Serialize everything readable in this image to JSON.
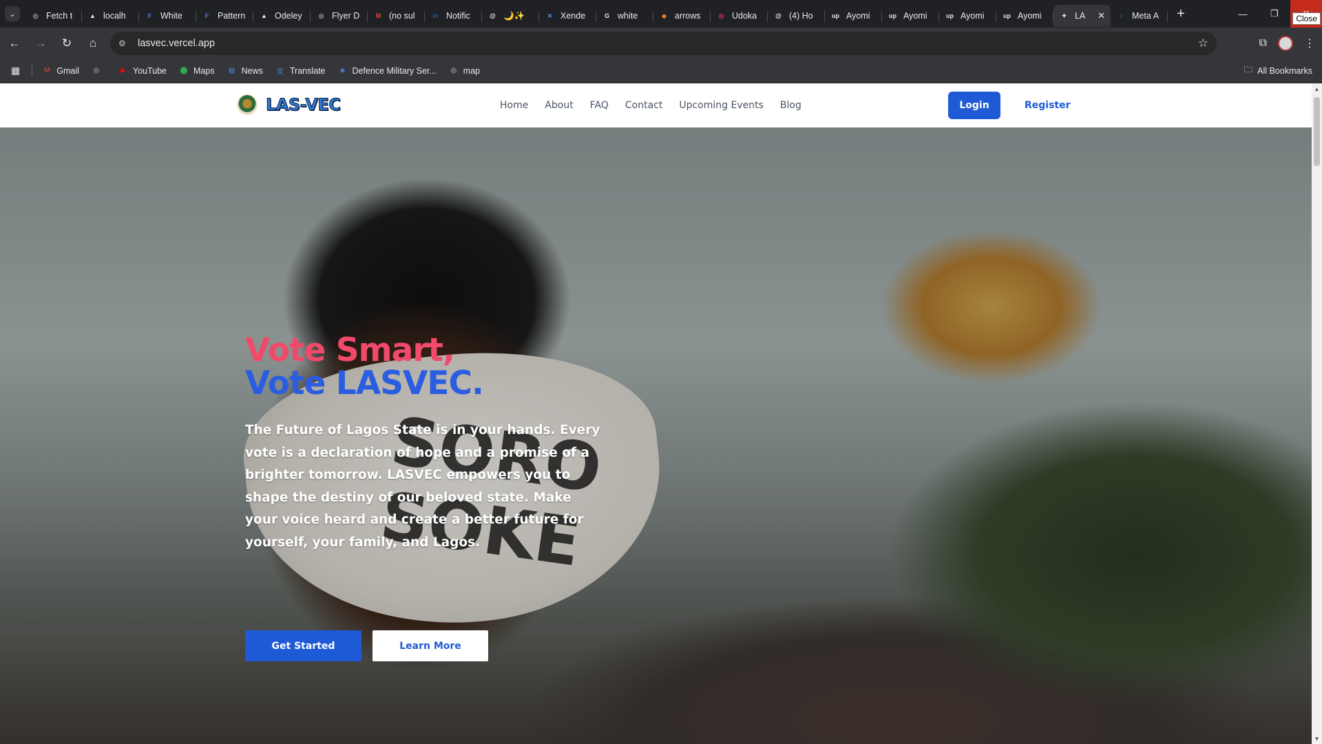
{
  "browser": {
    "tabs": [
      {
        "title": "Fetch t",
        "icon": "globe-icon",
        "color": "#9aa0a6"
      },
      {
        "title": "localh",
        "icon": "triangle-icon",
        "color": "#e8eaed"
      },
      {
        "title": "White",
        "icon": "f-icon",
        "color": "#4a7bd8"
      },
      {
        "title": "Pattern",
        "icon": "f-icon",
        "color": "#4a7bd8"
      },
      {
        "title": "Odeley",
        "icon": "triangle-icon",
        "color": "#e8eaed"
      },
      {
        "title": "Flyer D",
        "icon": "globe-icon",
        "color": "#9aa0a6"
      },
      {
        "title": "(no sul",
        "icon": "gmail-icon",
        "color": "#ea4335"
      },
      {
        "title": "Notific",
        "icon": "linkedin-icon",
        "color": "#0a66c2"
      },
      {
        "title": "🌙✨",
        "icon": "threads-icon",
        "color": "#e8eaed"
      },
      {
        "title": "Xende",
        "icon": "x-icon",
        "color": "#4a90e2"
      },
      {
        "title": "white",
        "icon": "google-icon",
        "color": "#e8eaed"
      },
      {
        "title": "arrows",
        "icon": "brave-icon",
        "color": "#f07b2c"
      },
      {
        "title": "Udoka",
        "icon": "instagram-icon",
        "color": "#d62976"
      },
      {
        "title": "(4) Ho",
        "icon": "threads-icon",
        "color": "#e8eaed"
      },
      {
        "title": "Ayomi",
        "icon": "upwork-icon",
        "color": "#e8eaed"
      },
      {
        "title": "Ayomi",
        "icon": "upwork-icon",
        "color": "#e8eaed"
      },
      {
        "title": "Ayomi",
        "icon": "upwork-icon",
        "color": "#e8eaed"
      },
      {
        "title": "Ayomi",
        "icon": "upwork-icon",
        "color": "#e8eaed"
      },
      {
        "title": "LA",
        "icon": "lasvec-icon",
        "color": "#e8eaed",
        "active": true
      },
      {
        "title": "Meta A",
        "icon": "meta-icon",
        "color": "#4a90e2"
      }
    ],
    "close_tooltip": "Close",
    "address": "lasvec.vercel.app",
    "bookmarks": [
      {
        "label": "Gmail",
        "icon": "gmail-icon"
      },
      {
        "label": "",
        "icon": "globe-icon"
      },
      {
        "label": "YouTube",
        "icon": "youtube-icon"
      },
      {
        "label": "Maps",
        "icon": "maps-icon"
      },
      {
        "label": "News",
        "icon": "news-icon"
      },
      {
        "label": "Translate",
        "icon": "translate-icon"
      },
      {
        "label": "Defence Military Ser...",
        "icon": "shield-icon"
      },
      {
        "label": "map",
        "icon": "globe-icon"
      }
    ],
    "all_bookmarks": "All Bookmarks"
  },
  "site": {
    "brand": "LAS-VEC",
    "nav": [
      "Home",
      "About",
      "FAQ",
      "Contact",
      "Upcoming Events",
      "Blog"
    ],
    "login": "Login",
    "register": "Register"
  },
  "hero": {
    "headline_1": "Vote Smart,",
    "headline_2": "Vote LASVEC.",
    "paragraph": "The Future of Lagos State is in your hands. Every vote is a declaration of hope and a promise of a brighter tomorrow. LASVEC empowers you to shape the destiny of our beloved state. Make your voice heard and create a better future for yourself, your family, and Lagos.",
    "mask_text_1": "SORO",
    "mask_text_2": "SOKE",
    "primary_cta": "Get Started",
    "secondary_cta": "Learn More"
  },
  "colors": {
    "accent_blue": "#1f5ad6",
    "headline_pink": "#f04a6a",
    "headline_blue": "#2b5de0"
  }
}
